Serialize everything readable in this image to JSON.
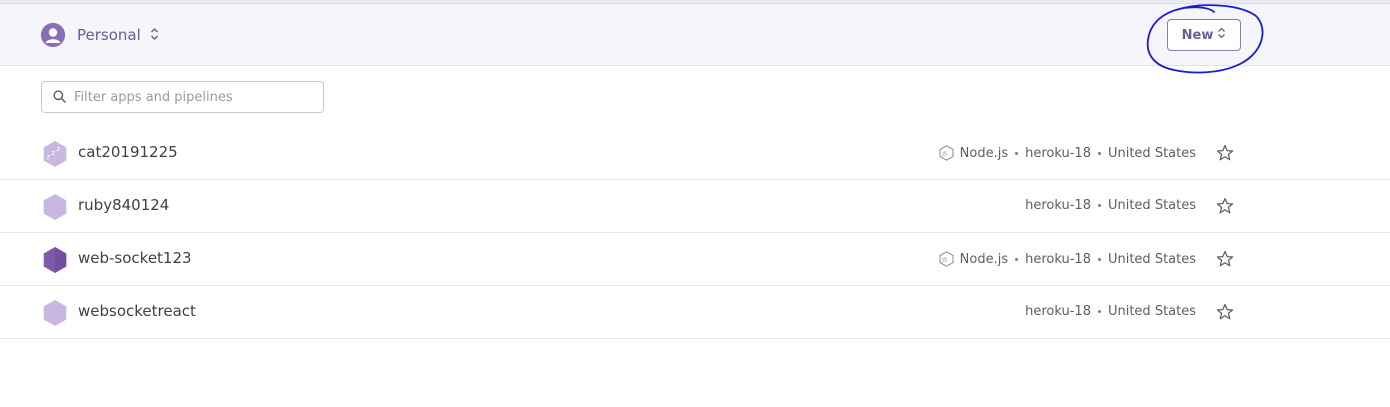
{
  "header": {
    "account_name": "Personal",
    "new_button_label": "New"
  },
  "filter": {
    "placeholder": "Filter apps and pipelines",
    "value": ""
  },
  "apps": [
    {
      "name": "cat20191225",
      "icon": "sleeping-app-icon",
      "language": "Node.js",
      "stack": "heroku-18",
      "region": "United States"
    },
    {
      "name": "ruby840124",
      "icon": "app-hexagon-icon",
      "language": "",
      "stack": "heroku-18",
      "region": "United States"
    },
    {
      "name": "web-socket123",
      "icon": "app-hexagon-icon",
      "language": "Node.js",
      "stack": "heroku-18",
      "region": "United States"
    },
    {
      "name": "websocketreact",
      "icon": "app-hexagon-icon",
      "language": "",
      "stack": "heroku-18",
      "region": "United States"
    }
  ],
  "colors": {
    "accent": "#79589f",
    "annotation": "#1a1ad6"
  }
}
